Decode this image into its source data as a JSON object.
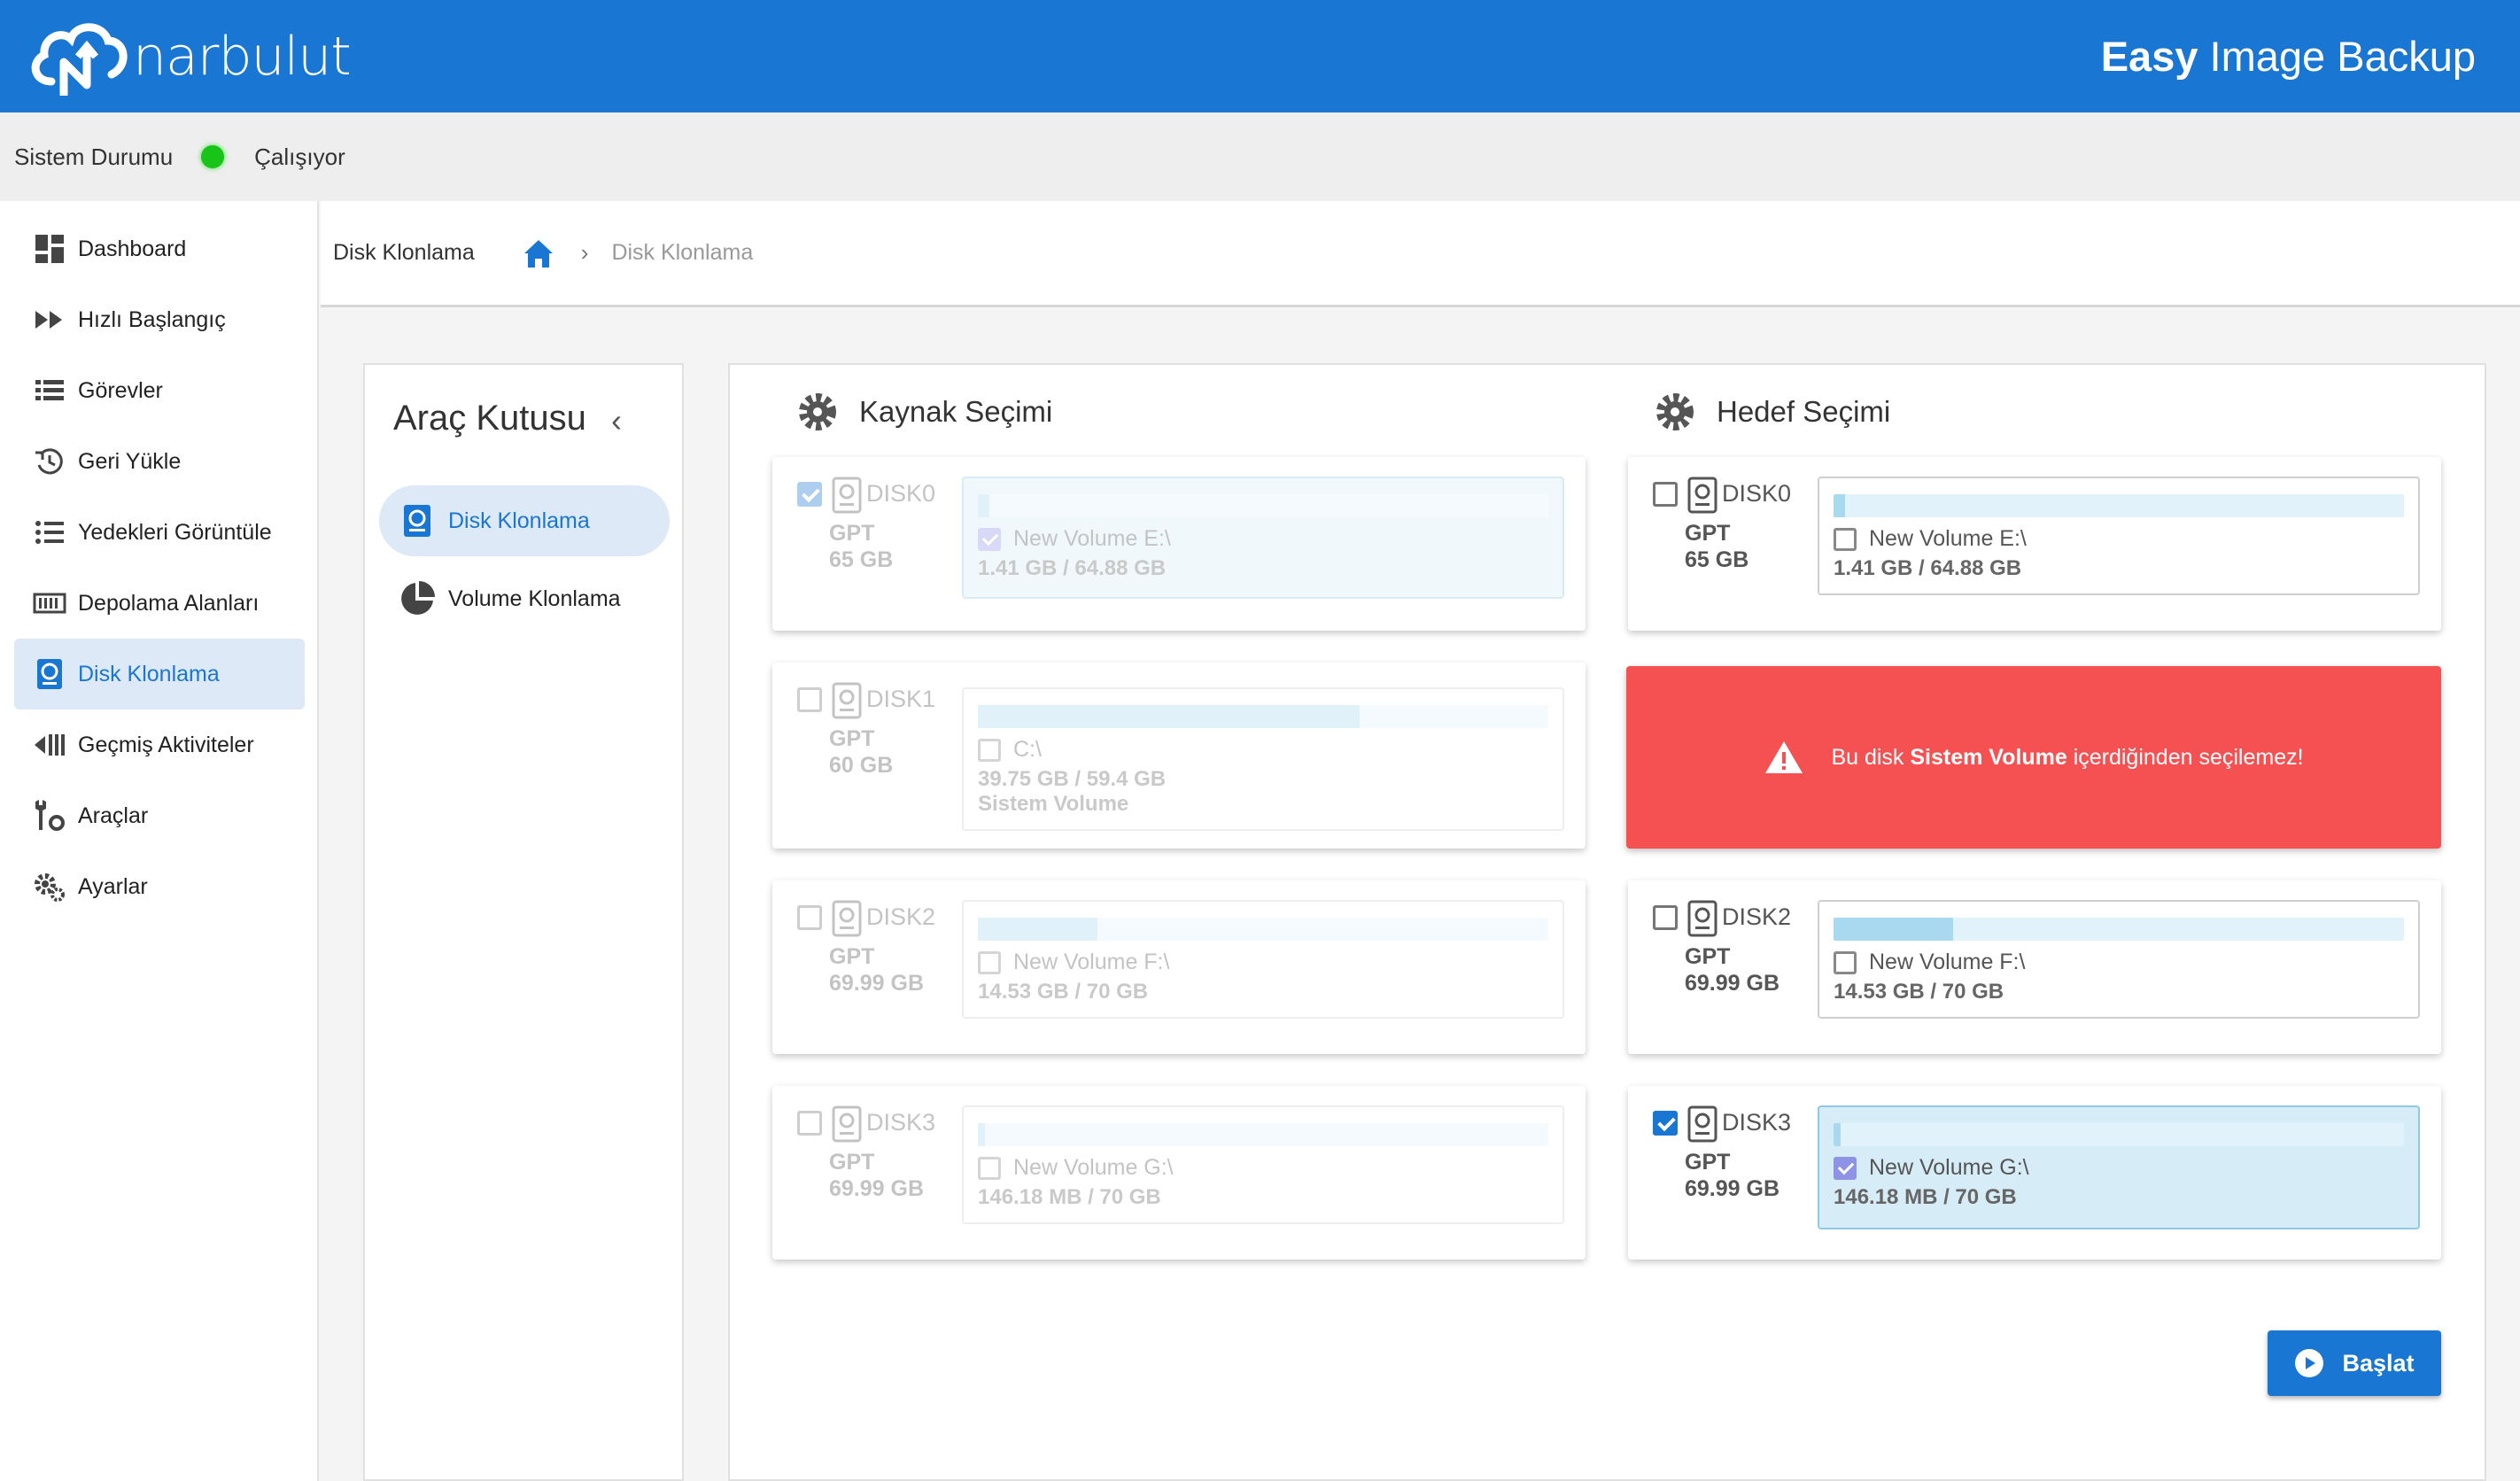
{
  "header": {
    "logo_text": "narbulut",
    "app_title_bold": "Easy",
    "app_title_rest": " Image Backup"
  },
  "status": {
    "label": "Sistem Durumu",
    "value": "Çalışıyor",
    "color": "#18c418"
  },
  "sidebar": {
    "items": [
      {
        "label": "Dashboard",
        "icon": "dashboard-icon"
      },
      {
        "label": "Hızlı Başlangıç",
        "icon": "fast-forward-icon"
      },
      {
        "label": "Görevler",
        "icon": "list-icon"
      },
      {
        "label": "Geri Yükle",
        "icon": "restore-icon"
      },
      {
        "label": "Yedekleri Görüntüle",
        "icon": "view-list-icon"
      },
      {
        "label": "Depolama Alanları",
        "icon": "storage-icon"
      },
      {
        "label": "Disk Klonlama",
        "icon": "disk-icon",
        "active": true
      },
      {
        "label": "Geçmiş Aktiviteler",
        "icon": "history-icon"
      },
      {
        "label": "Araçlar",
        "icon": "tools-icon"
      },
      {
        "label": "Ayarlar",
        "icon": "gears-icon"
      }
    ]
  },
  "breadcrumb": {
    "title": "Disk Klonlama",
    "separator": "›",
    "current": "Disk Klonlama"
  },
  "toolbox": {
    "title": "Araç Kutusu",
    "collapse": "‹",
    "items": [
      {
        "label": "Disk Klonlama",
        "active": true
      },
      {
        "label": "Volume Klonlama"
      }
    ]
  },
  "source": {
    "title": "Kaynak Seçimi",
    "disks": [
      {
        "name": "DISK0",
        "type": "GPT",
        "size": "65 GB",
        "checked": true,
        "vol_name": "New Volume E:\\",
        "vol_size": "1.41 GB / 64.88 GB",
        "usage": 0.02,
        "vol_checked": true
      },
      {
        "name": "DISK1",
        "type": "GPT",
        "size": "60 GB",
        "checked": false,
        "vol_name": "C:\\",
        "vol_size": "39.75 GB / 59.4 GB",
        "vol_note": "Sistem Volume",
        "usage": 0.67,
        "vol_checked": false
      },
      {
        "name": "DISK2",
        "type": "GPT",
        "size": "69.99 GB",
        "checked": false,
        "vol_name": "New Volume F:\\",
        "vol_size": "14.53 GB / 70 GB",
        "usage": 0.21,
        "vol_checked": false
      },
      {
        "name": "DISK3",
        "type": "GPT",
        "size": "69.99 GB",
        "checked": false,
        "vol_name": "New Volume G:\\",
        "vol_size": "146.18 MB / 70 GB",
        "usage": 0.002,
        "vol_checked": false
      }
    ]
  },
  "target": {
    "title": "Hedef Seçimi",
    "disks": [
      {
        "name": "DISK0",
        "type": "GPT",
        "size": "65 GB",
        "checked": false,
        "vol_name": "New Volume E:\\",
        "vol_size": "1.41 GB / 64.88 GB",
        "usage": 0.02,
        "vol_checked": false
      },
      {
        "name": "DISK2",
        "type": "GPT",
        "size": "69.99 GB",
        "checked": false,
        "vol_name": "New Volume F:\\",
        "vol_size": "14.53 GB / 70 GB",
        "usage": 0.21,
        "vol_checked": false
      },
      {
        "name": "DISK3",
        "type": "GPT",
        "size": "69.99 GB",
        "checked": true,
        "vol_name": "New Volume G:\\",
        "vol_size": "146.18 MB / 70 GB",
        "usage": 0.002,
        "vol_checked": true
      }
    ],
    "alert_prefix": "Bu disk ",
    "alert_bold": "Sistem Volume",
    "alert_suffix": " içerdiğinden seçilemez!",
    "alert_color": "#f55152"
  },
  "actions": {
    "start_label": "Başlat"
  }
}
